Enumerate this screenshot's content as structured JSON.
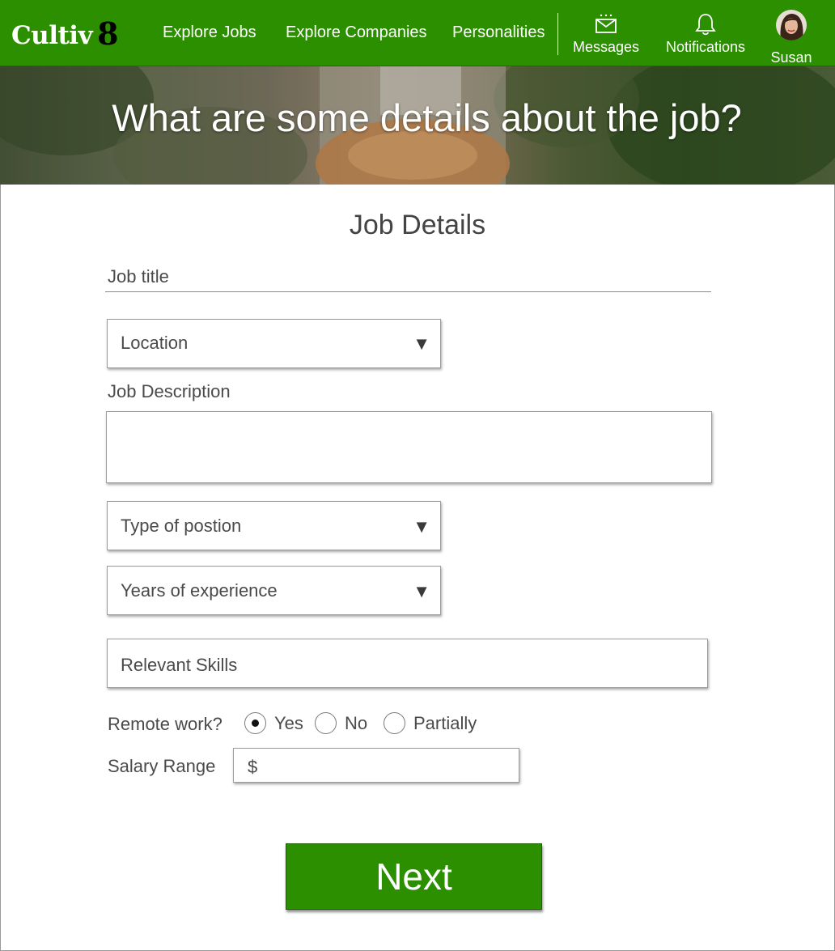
{
  "nav": {
    "logo_text": "Cultiv",
    "logo_num": "8",
    "links": [
      "Explore Jobs",
      "Explore Companies",
      "Personalities"
    ],
    "messages_label": "Messages",
    "notifications_label": "Notifications",
    "user_label": "Susan",
    "icons": {
      "messages": "envelope-icon",
      "notifications": "bell-icon",
      "user": "avatar"
    }
  },
  "hero": {
    "title": "What are some details about the job?"
  },
  "form": {
    "section_title": "Job Details",
    "job_title_placeholder": "Job title",
    "location_label": "Location",
    "description_label": "Job Description",
    "position_type_label": "Type of postion",
    "experience_label": "Years of experience",
    "skills_label": "Relevant Skills",
    "remote_label": "Remote work?",
    "remote_options": [
      {
        "label": "Yes",
        "selected": true
      },
      {
        "label": "No",
        "selected": false
      },
      {
        "label": "Partially",
        "selected": false
      }
    ],
    "salary_label": "Salary Range",
    "salary_prefix": "$",
    "dropdown_arrow": "▼",
    "next_label": "Next"
  },
  "colors": {
    "brand_green": "#2b8f00",
    "text": "#4a4a4a"
  }
}
